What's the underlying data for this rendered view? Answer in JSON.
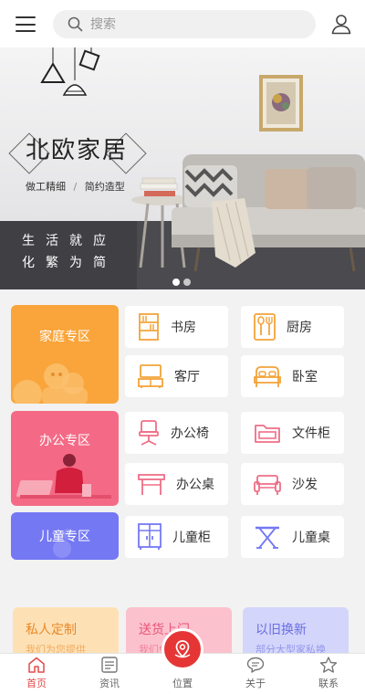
{
  "header": {
    "search_placeholder": "搜索"
  },
  "banner": {
    "title": "北欧家居",
    "subtitle_left": "做工精细",
    "subtitle_sep": "/",
    "subtitle_right": "简约造型",
    "slogan": "生活就应化繁为简",
    "slide_count": 2,
    "active_slide": 1
  },
  "zones": {
    "family": "家庭专区",
    "office": "办公专区",
    "kids": "儿童专区"
  },
  "categories": {
    "study": "书房",
    "kitchen": "厨房",
    "living": "客厅",
    "bedroom": "卧室",
    "office_chair": "办公椅",
    "file_cabinet": "文件柜",
    "office_desk": "办公桌",
    "sofa": "沙发",
    "kids_cabinet": "儿童柜",
    "kids_desk": "儿童桌"
  },
  "services": [
    {
      "title": "私人定制",
      "desc": "我们为您提供"
    },
    {
      "title": "送货上门",
      "desc": "我们免费配送"
    },
    {
      "title": "以旧换新",
      "desc": "部分大型家私换"
    }
  ],
  "tabbar": {
    "home": "首页",
    "news": "资讯",
    "location": "位置",
    "about": "关于",
    "contact": "联系",
    "active": "home"
  },
  "colors": {
    "accent": "#e24b4b",
    "family_zone": "#f9a53b",
    "office_zone": "#f46a86",
    "kids_zone": "#7478f3"
  }
}
